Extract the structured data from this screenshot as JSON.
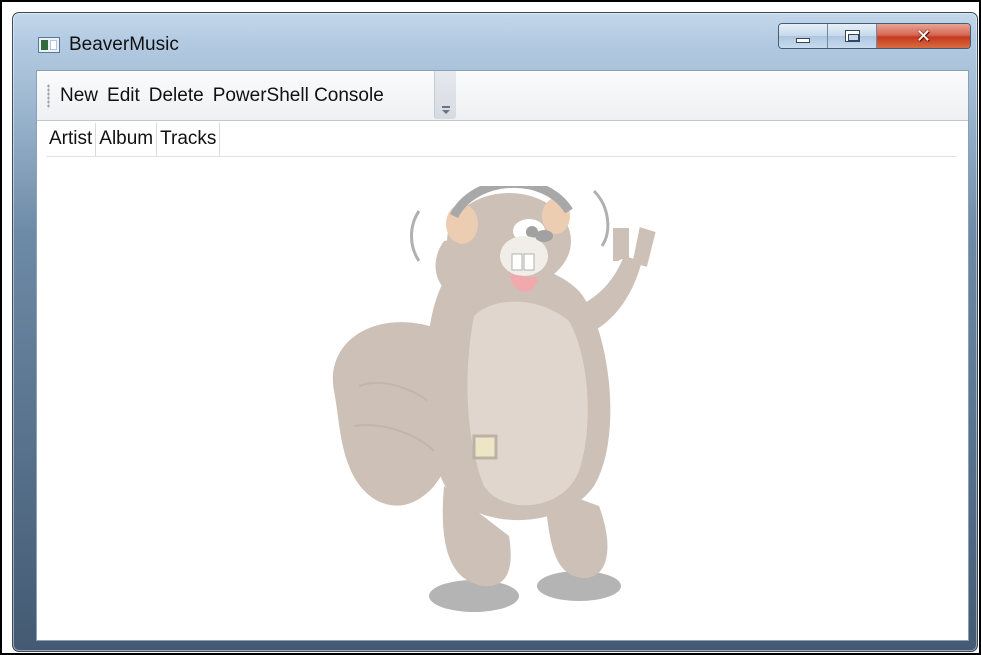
{
  "window": {
    "title": "BeaverMusic"
  },
  "toolbar": {
    "items": [
      "New",
      "Edit",
      "Delete",
      "PowerShell Console"
    ]
  },
  "grid": {
    "columns": [
      "Artist",
      "Album",
      "Tracks"
    ]
  },
  "colors": {
    "mascot_fur": "#8a6b53",
    "mascot_belly": "#b8a08a",
    "close_button": "#c7391f",
    "titlebar": "#b3cbe2"
  },
  "icons": {
    "app": "app-window-icon",
    "minimize": "minimize-icon",
    "maximize": "maximize-icon",
    "close": "close-icon",
    "overflow": "chevron-down-icon"
  }
}
